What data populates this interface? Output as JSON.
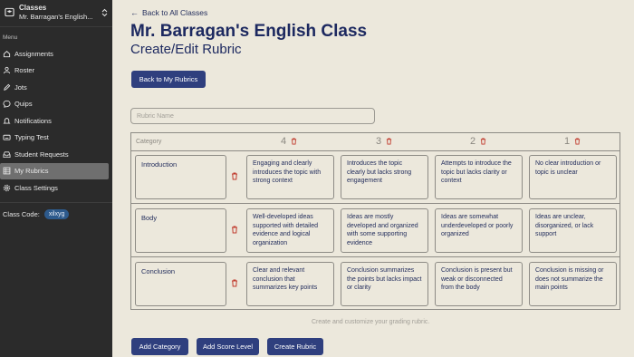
{
  "colors": {
    "sidebar_bg": "#2b2b2b",
    "accent": "#2f3f7e",
    "trash": "#c0392b",
    "page_bg": "#ece8dc"
  },
  "sidebar": {
    "class_title": "Classes",
    "class_name": "Mr. Barragan's English...",
    "menu_label": "Menu",
    "items": [
      {
        "label": "Assignments",
        "icon": "home-icon"
      },
      {
        "label": "Roster",
        "icon": "user-icon"
      },
      {
        "label": "Jots",
        "icon": "pencil-icon"
      },
      {
        "label": "Quips",
        "icon": "chat-icon"
      },
      {
        "label": "Notifications",
        "icon": "bell-icon"
      },
      {
        "label": "Typing Test",
        "icon": "keyboard-icon"
      },
      {
        "label": "Student Requests",
        "icon": "inbox-icon"
      },
      {
        "label": "My Rubrics",
        "icon": "rubric-icon",
        "active": true
      },
      {
        "label": "Class Settings",
        "icon": "gear-icon"
      }
    ],
    "class_code_label": "Class Code:",
    "class_code": "xilxyg"
  },
  "main": {
    "back_link": "Back to All Classes",
    "title": "Mr. Barragan's English Class",
    "subtitle": "Create/Edit Rubric",
    "back_rubrics_button": "Back to My Rubrics",
    "rubric_name_placeholder": "Rubric Name",
    "help_text": "Create and customize your grading rubric.",
    "buttons": {
      "add_category": "Add Category",
      "add_score_level": "Add Score Level",
      "create_rubric": "Create Rubric"
    }
  },
  "rubric": {
    "category_header": "Category",
    "levels": [
      "4",
      "3",
      "2",
      "1"
    ],
    "rows": [
      {
        "category": "Introduction",
        "cells": [
          "Engaging and clearly introduces the topic with strong context",
          "Introduces the topic clearly but lacks strong engagement",
          "Attempts to introduce the topic but lacks clarity or context",
          "No clear introduction or topic is unclear"
        ]
      },
      {
        "category": "Body",
        "cells": [
          "Well-developed ideas supported with detailed evidence and logical organization",
          "Ideas are mostly developed and organized with some supporting evidence",
          "Ideas are somewhat underdeveloped or poorly organized",
          "Ideas are unclear, disorganized, or lack support"
        ]
      },
      {
        "category": "Conclusion",
        "cells": [
          "Clear and relevant conclusion that summarizes key points",
          "Conclusion summarizes the points but lacks impact or clarity",
          "Conclusion is present but weak or disconnected from the body",
          "Conclusion is missing or does not summarize the main points"
        ]
      }
    ]
  }
}
